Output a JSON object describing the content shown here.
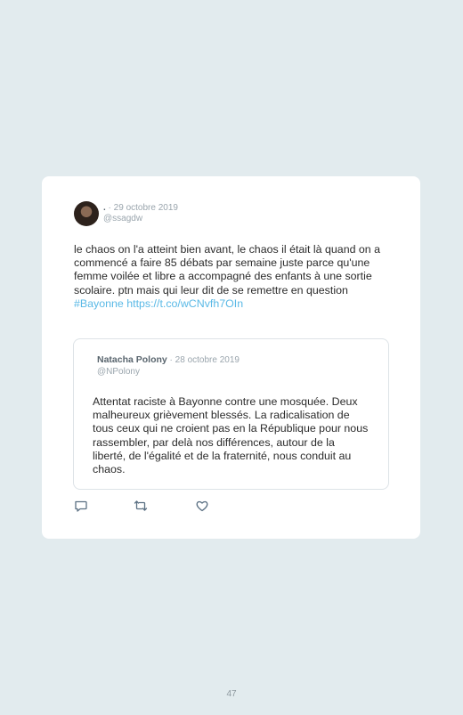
{
  "tweet": {
    "author_name": ".",
    "separator": " · ",
    "date": "29 octobre 2019",
    "handle": "@ssagdw",
    "text": "le chaos on l'a atteint bien avant, le chaos il était là quand on a commencé a faire 85 débats par semaine juste parce qu'une femme voilée et libre a accompagné des enfants à une sortie scolaire. ptn mais qui leur dit de se remettre en question",
    "link_text": "#Bayonne https://t.co/wCNvfh7OIn"
  },
  "quoted_tweet": {
    "author_name": "Natacha Polony",
    "separator": " · ",
    "date": "28 octobre 2019",
    "handle": "@NPolony",
    "text": "Attentat raciste à Bayonne contre une mosquée. Deux malheureux grièvement blessés. La radicalisation de tous ceux qui ne croient pas en la République pour nous rassembler, par delà nos différences, autour de la liberté, de l'égalité et de la fraternité, nous conduit au chaos."
  },
  "actions": {
    "icons": [
      "reply-icon",
      "retweet-icon",
      "like-icon"
    ]
  },
  "colors": {
    "background": "#e2ebee",
    "card": "#ffffff",
    "link": "#5ab9e6",
    "meta": "#9aa5ad"
  },
  "page": {
    "number": "47"
  }
}
